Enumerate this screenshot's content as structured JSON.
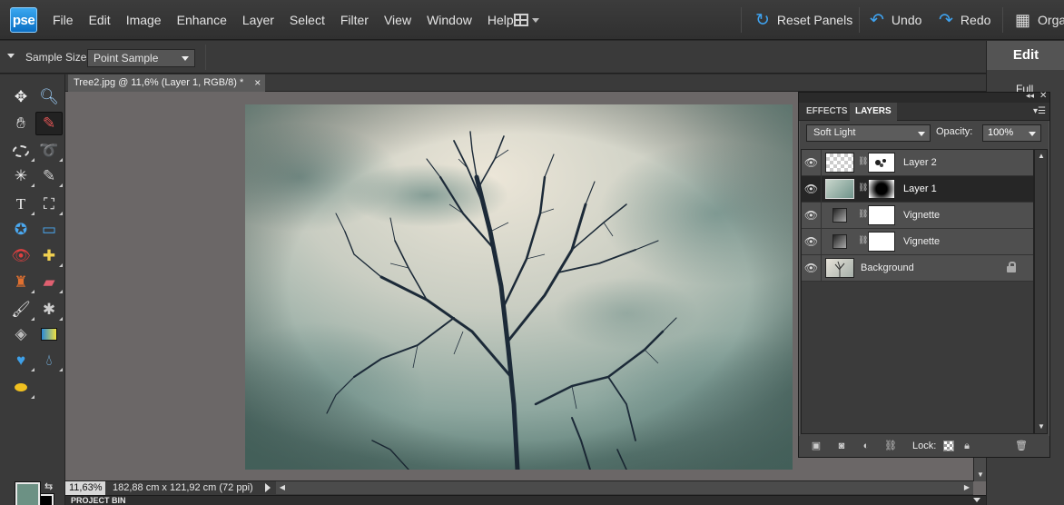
{
  "app": {
    "logo_text": "pse"
  },
  "menu": [
    "File",
    "Edit",
    "Image",
    "Enhance",
    "Layer",
    "Select",
    "Filter",
    "View",
    "Window",
    "Help"
  ],
  "top_actions": {
    "reset_panels": "Reset Panels",
    "undo": "Undo",
    "redo": "Redo",
    "organizer": "Orga"
  },
  "options_bar": {
    "sample_size_label": "Sample Size:",
    "sample_size_value": "Point Sample"
  },
  "right_panel": {
    "edit_tab": "Edit",
    "full_label": "Full"
  },
  "document": {
    "tab_title": "Tree2.jpg @ 11,6% (Layer 1, RGB/8) *",
    "tab_close": "×",
    "zoom": "11,63%",
    "dimensions": "182,88 cm x 121,92 cm (72 ppi)"
  },
  "project_bin": {
    "label": "PROJECT BIN"
  },
  "layers_panel": {
    "tabs": [
      "EFFECTS",
      "LAYERS"
    ],
    "active_tab": "LAYERS",
    "blend_mode": "Soft Light",
    "opacity_label": "Opacity:",
    "opacity_value": "100%",
    "layers": [
      {
        "name": "Layer 2",
        "selected": false
      },
      {
        "name": "Layer 1",
        "selected": true
      },
      {
        "name": "Vignette",
        "selected": false
      },
      {
        "name": "Vignette",
        "selected": false
      },
      {
        "name": "Background",
        "selected": false,
        "locked": true
      }
    ],
    "lock_label": "Lock:"
  },
  "colors": {
    "foreground": "#6c9184",
    "background": "#000000",
    "accent": "#3fa3f0"
  }
}
